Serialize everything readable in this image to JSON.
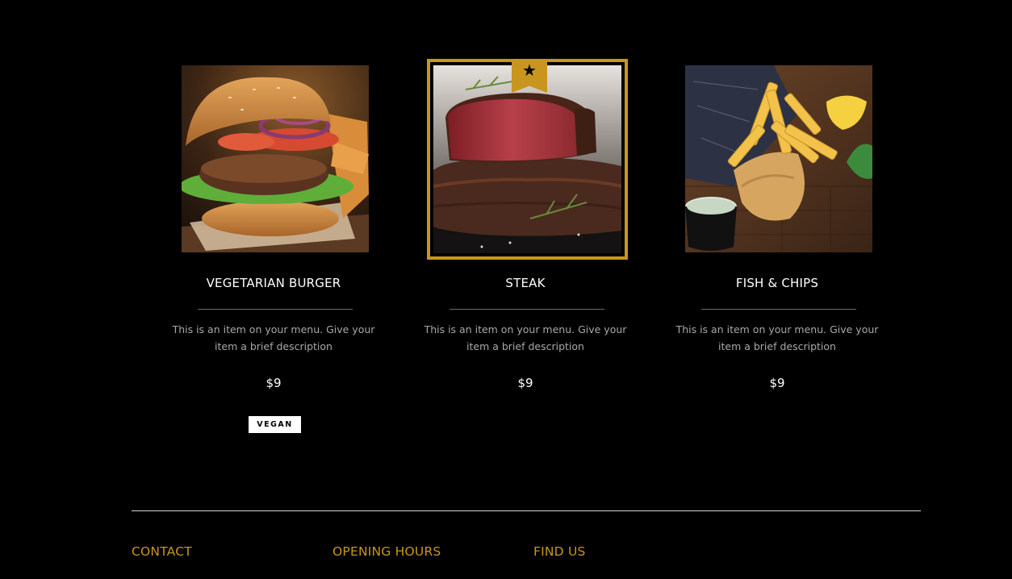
{
  "menu_items": [
    {
      "title": "VEGETARIAN BURGER",
      "description_line1": "This is an item on your menu. Give your",
      "description_line2": "item a brief description",
      "price": "$9",
      "badge": "VEGAN",
      "featured": false,
      "image_icon": "burger-image"
    },
    {
      "title": "STEAK",
      "description_line1": "This is an item on your menu. Give your",
      "description_line2": "item a brief description",
      "price": "$9",
      "featured": true,
      "ribbon_icon": "star-icon",
      "image_icon": "steak-image"
    },
    {
      "title": "FISH & CHIPS",
      "description_line1": "This is an item on your menu. Give your",
      "description_line2": "item a brief description",
      "price": "$9",
      "featured": false,
      "image_icon": "fish-and-chips-image"
    }
  ],
  "footer": {
    "contact": "CONTACT",
    "opening_hours": "OPENING HOURS",
    "find_us": "FIND US"
  },
  "colors": {
    "background": "#000000",
    "accent_gold": "#c8961e",
    "text_primary": "#ffffff",
    "text_muted": "#a8a8a8",
    "divider": "#6a6a6a"
  }
}
